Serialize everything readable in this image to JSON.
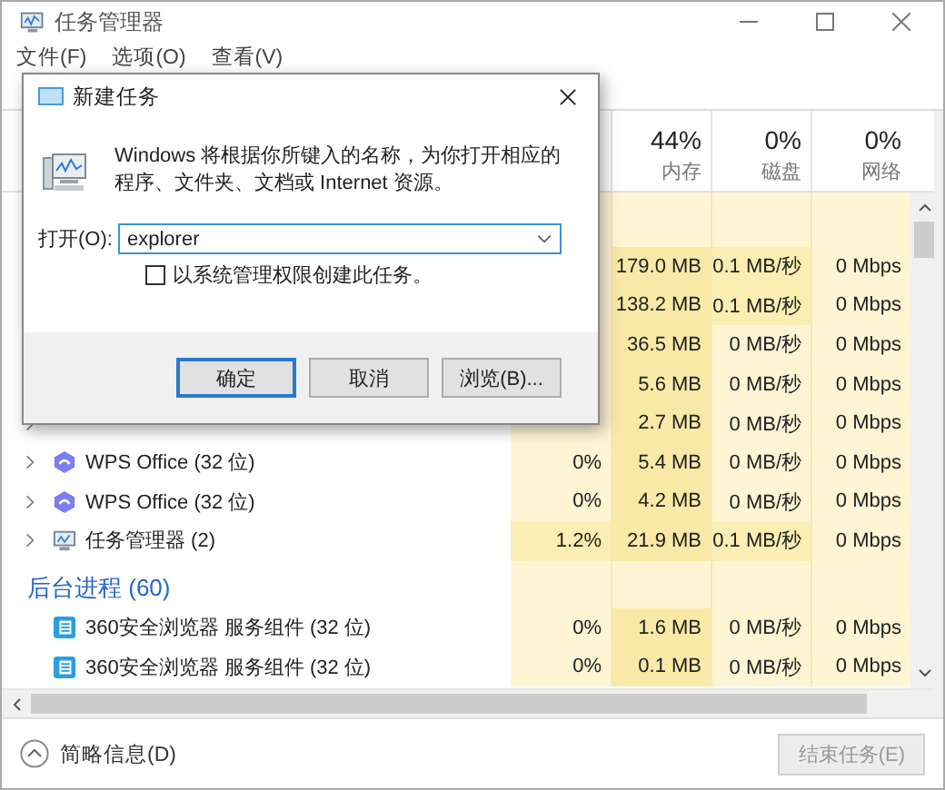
{
  "window": {
    "title": "任务管理器"
  },
  "menu": [
    {
      "label": "文件(F)"
    },
    {
      "label": "选项(O)"
    },
    {
      "label": "查看(V)"
    }
  ],
  "columns": [
    {
      "percent": "44%",
      "label": "内存"
    },
    {
      "percent": "0%",
      "label": "磁盘"
    },
    {
      "percent": "0%",
      "label": "网络"
    }
  ],
  "rows": [
    {
      "kind": "group"
    },
    {
      "kind": "app",
      "memory": "179.0 MB",
      "disk": "0.1 MB/秒",
      "network": "0 Mbps",
      "cpu_active": false,
      "disk_active": true
    },
    {
      "kind": "app",
      "memory": "138.2 MB",
      "disk": "0.1 MB/秒",
      "network": "0 Mbps",
      "cpu_active": false,
      "disk_active": true
    },
    {
      "kind": "app",
      "memory": "36.5 MB",
      "disk": "0 MB/秒",
      "network": "0 Mbps",
      "cpu_active": false,
      "disk_active": false
    },
    {
      "kind": "app",
      "memory": "5.6 MB",
      "disk": "0 MB/秒",
      "network": "0 Mbps",
      "cpu_active": false,
      "disk_active": false
    },
    {
      "kind": "app",
      "memory": "2.7 MB",
      "disk": "0 MB/秒",
      "network": "0 Mbps",
      "cpu_active": false,
      "disk_active": false
    },
    {
      "kind": "hexagon-app",
      "name": "WPS Office (32 位)",
      "cpu": "0%",
      "memory": "5.4 MB",
      "disk": "0 MB/秒",
      "network": "0 Mbps",
      "cpu_active": false,
      "disk_active": false
    },
    {
      "kind": "hexagon-app",
      "name": "WPS Office (32 位)",
      "cpu": "0%",
      "memory": "4.2 MB",
      "disk": "0 MB/秒",
      "network": "0 Mbps",
      "cpu_active": false,
      "disk_active": false
    },
    {
      "kind": "monitor-app",
      "name": "任务管理器 (2)",
      "cpu": "1.2%",
      "memory": "21.9 MB",
      "disk": "0.1 MB/秒",
      "network": "0 Mbps",
      "cpu_active": true,
      "disk_active": true
    },
    {
      "kind": "group",
      "title": "后台进程 (60)"
    },
    {
      "kind": "service",
      "name": "360安全浏览器 服务组件 (32 位)",
      "cpu": "0%",
      "memory": "1.6 MB",
      "disk": "0 MB/秒",
      "network": "0 Mbps",
      "cpu_active": false,
      "disk_active": false
    },
    {
      "kind": "service",
      "name": "360安全浏览器 服务组件 (32 位)",
      "cpu": "0%",
      "memory": "0.1 MB",
      "disk": "0 MB/秒",
      "network": "0 Mbps",
      "cpu_active": false,
      "disk_active": false
    }
  ],
  "footer": {
    "details": "简略信息(D)",
    "end_task": {
      "label": "结束任务(E)",
      "disabled": true
    }
  },
  "dialog": {
    "title": "新建任务",
    "description": "Windows 将根据你所键入的名称，为你打开相应的程序、文件夹、文档或 Internet 资源。",
    "open_label": "打开(O):",
    "value": "explorer",
    "admin_checkbox": {
      "label": "以系统管理权限创建此任务。",
      "checked": false
    },
    "buttons": [
      {
        "label": "确定",
        "default": true
      },
      {
        "label": "取消",
        "default": false
      },
      {
        "label": "浏览(B)...",
        "default": false
      }
    ]
  }
}
